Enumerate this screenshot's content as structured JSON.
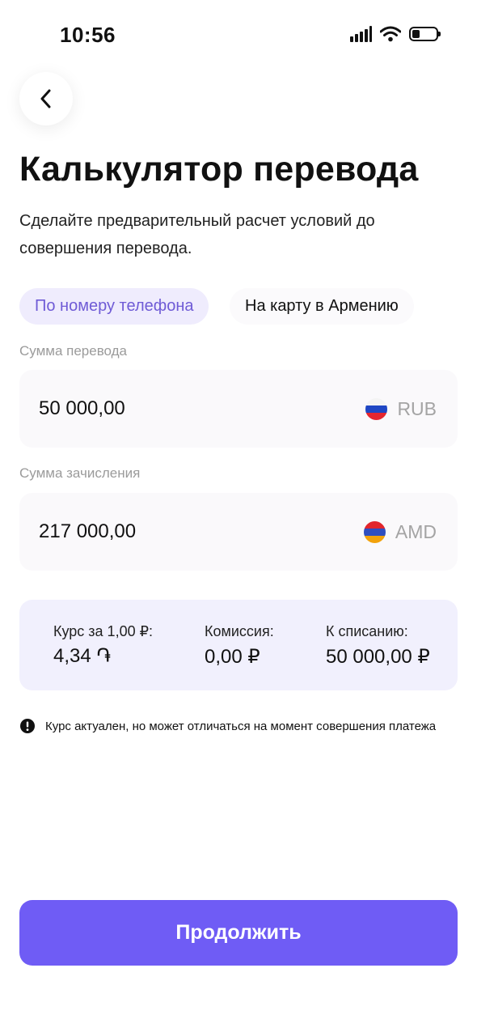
{
  "status_bar": {
    "time": "10:56",
    "icons": [
      "signal-icon",
      "wifi-icon",
      "battery-icon"
    ]
  },
  "header": {
    "back_icon": "chevron-left-icon",
    "title": "Калькулятор перевода",
    "subtitle": "Сделайте предварительный расчет условий до совершения перевода."
  },
  "tabs": [
    {
      "label": "По номеру телефона",
      "active": true
    },
    {
      "label": "На карту в Армению",
      "active": false
    }
  ],
  "transfer": {
    "label": "Сумма перевода",
    "value": "50 000,00",
    "currency": "RUB",
    "flag": "russia-flag-icon"
  },
  "credit": {
    "label": "Сумма зачисления",
    "value": "217 000,00",
    "currency": "AMD",
    "flag": "armenia-flag-icon"
  },
  "summary": {
    "rate_label": "Курс за 1,00 ₽:",
    "rate_value": "4,34 ֏",
    "fee_label": "Комиссия:",
    "fee_value": "0,00 ₽",
    "debit_label": "К списанию:",
    "debit_value": "50 000,00 ₽"
  },
  "notice": {
    "icon": "exclamation-circle-icon",
    "text": "Курс актуален, но может отличаться на момент совершения платежа"
  },
  "continue_label": "Продолжить",
  "colors": {
    "accent": "#6F5CF5",
    "tab_active_bg": "#EFECFD",
    "tab_active_text": "#6F5BD6",
    "info_bg": "#F1F0FD",
    "field_bg": "#FAF9FB"
  }
}
